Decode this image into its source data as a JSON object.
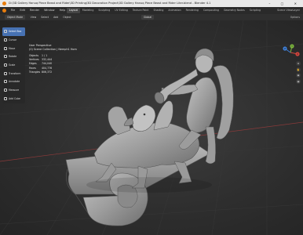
{
  "window": {
    "title": "D:\\3D Gallery Hanuq Piece Beast and Rider\\3D Printing\\3D Decoration Project\\3D Gallery Hanuq Piece Beast and Rider Liter.blend - Blender 4.1",
    "controls": "– ▢ ✕"
  },
  "menu": [
    "File",
    "Edit",
    "Render",
    "Window",
    "Help"
  ],
  "workspaces": [
    "Layout",
    "Modeling",
    "Sculpting",
    "UV Editing",
    "Texture Paint",
    "Shading",
    "Animation",
    "Rendering",
    "Compositing",
    "Geometry Nodes",
    "Scripting"
  ],
  "active_workspace": "Layout",
  "topbar_right": "Scene   ViewLayer",
  "header": {
    "mode": "Object Mode",
    "menus": [
      "View",
      "Select",
      "Add",
      "Object"
    ],
    "orientation": "Global",
    "right": "Options"
  },
  "tools": [
    {
      "label": "Select Box",
      "icon": "select-box-icon",
      "active": true
    },
    {
      "label": "Cursor",
      "icon": "cursor-icon",
      "active": false
    },
    {
      "label": "Move",
      "icon": "move-icon",
      "active": false
    },
    {
      "label": "Rotate",
      "icon": "rotate-icon",
      "active": false
    },
    {
      "label": "Scale",
      "icon": "scale-icon",
      "active": false
    },
    {
      "label": "Transform",
      "icon": "transform-icon",
      "active": false
    },
    {
      "label": "Annotate",
      "icon": "annotate-icon",
      "active": false
    },
    {
      "label": "Measure",
      "icon": "measure-icon",
      "active": false
    },
    {
      "label": "Add Cube",
      "icon": "add-cube-icon",
      "active": false
    }
  ],
  "viewport": {
    "view_name": "User Perspective",
    "collection": "(0) Scene Collection | Nemph1 Hom",
    "stats": [
      {
        "label": "Objects",
        "value": "1 / 1"
      },
      {
        "label": "Vertices",
        "value": "332,444"
      },
      {
        "label": "Edges",
        "value": "744,040"
      },
      {
        "label": "Faces",
        "value": "404,776"
      },
      {
        "label": "Triangles",
        "value": "806,372"
      }
    ]
  },
  "gizmo": {
    "x": "X",
    "y": "Y",
    "z": "Z"
  },
  "colors": {
    "accent": "#e87d0d",
    "active_tool": "#4772b3",
    "model": "#a7a7a7"
  }
}
